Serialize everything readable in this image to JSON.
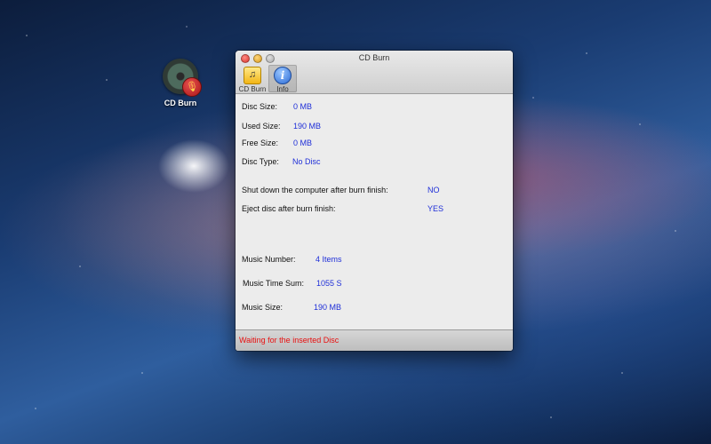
{
  "desktop": {
    "icon_label": "CD Burn"
  },
  "window": {
    "title": "CD Burn",
    "toolbar": {
      "cd_burn_label": "CD Burn",
      "info_label": "Info"
    },
    "disc": {
      "size_label": "Disc Size:",
      "size_value": "0 MB",
      "used_label": "Used Size:",
      "used_value": "190 MB",
      "free_label": "Free Size:",
      "free_value": "0 MB",
      "type_label": "Disc Type:",
      "type_value": "No Disc"
    },
    "options": {
      "shutdown_label": "Shut down the computer after burn finish:",
      "shutdown_value": "NO",
      "eject_label": "Eject disc after burn finish:",
      "eject_value": "YES"
    },
    "music": {
      "number_label": "Music Number:",
      "number_value": "4 Items",
      "time_label": "Music Time Sum:",
      "time_value": "1055 S",
      "size_label": "Music Size:",
      "size_value": "190 MB"
    },
    "status": "Waiting for the inserted Disc"
  },
  "colors": {
    "value_text": "#1f2fd8",
    "status_text": "#e81010"
  }
}
